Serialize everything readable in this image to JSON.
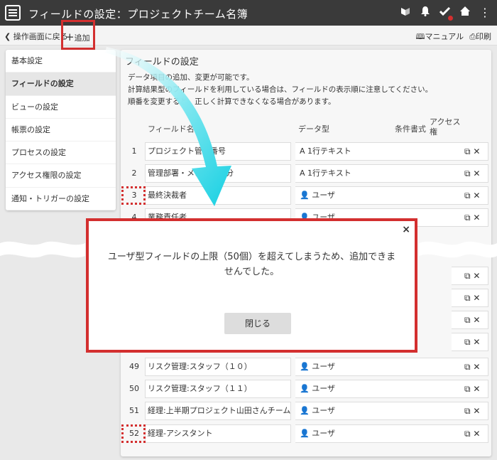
{
  "header": {
    "title": "フィールドの設定：プロジェクトチーム名簿",
    "icons": [
      "menu-icon",
      "learn-icon",
      "bell-icon",
      "check-icon",
      "home-icon",
      "more-icon"
    ],
    "more_glyph": "⋮"
  },
  "toolbar": {
    "back_label": "操作画面に戻る",
    "add_label": "追加",
    "manual_label": "マニュアル",
    "print_label": "印刷"
  },
  "sidebar": {
    "items": [
      {
        "label": "基本設定"
      },
      {
        "label": "フィールドの設定"
      },
      {
        "label": "ビューの設定"
      },
      {
        "label": "帳票の設定"
      },
      {
        "label": "プロセスの設定"
      },
      {
        "label": "アクセス権限の設定"
      },
      {
        "label": "通知・トリガーの設定"
      }
    ]
  },
  "main": {
    "title": "フィールドの設定",
    "desc": [
      "データ項目の追加、変更が可能です。",
      "計算結果型のフィールドを利用している場合は、フィールドの表示順に注意してください。",
      "順番を変更すると、正しく計算できなくなる場合があります。"
    ],
    "columns": {
      "field": "フィールド名",
      "type": "データ型",
      "cond": "条件書式",
      "access": "アクセス",
      "access2": "権"
    },
    "rows_top": [
      {
        "num": "1",
        "name": "プロジェクト管理番号",
        "type": "1行テキスト",
        "icon": "text-type-icon"
      },
      {
        "num": "2",
        "name": "管理部署・メンバー区分",
        "type": "1行テキスト",
        "icon": "text-type-icon"
      },
      {
        "num": "3",
        "name": "最終決裁者",
        "type": "ユーザ",
        "icon": "user-type-icon"
      },
      {
        "num": "4",
        "name": "業務責任者",
        "type": "ユーザ",
        "icon": "user-type-icon"
      }
    ],
    "rows_bottom": [
      {
        "num": "49",
        "name": "リスク管理:スタッフ（１０）",
        "type": "ユーザ",
        "icon": "user-type-icon"
      },
      {
        "num": "50",
        "name": "リスク管理:スタッフ（１１）",
        "type": "ユーザ",
        "icon": "user-type-icon"
      },
      {
        "num": "51",
        "name": "経理:上半期プロジェクト山田さんチーム",
        "type": "ユーザ",
        "icon": "user-type-icon"
      },
      {
        "num": "52",
        "name": "経理-アシスタント",
        "type": "ユーザ",
        "icon": "user-type-icon"
      }
    ]
  },
  "modal": {
    "message_line1": "ユーザ型フィールドの上限（50個）を超えてしまうため、追加できま",
    "message_line2": "せんでした。",
    "close_label": "閉じる",
    "close_glyph": "×"
  },
  "colors": {
    "highlight": "#d32f2f",
    "arrow": "#27d3e3",
    "topbar": "#3a3a3a"
  }
}
